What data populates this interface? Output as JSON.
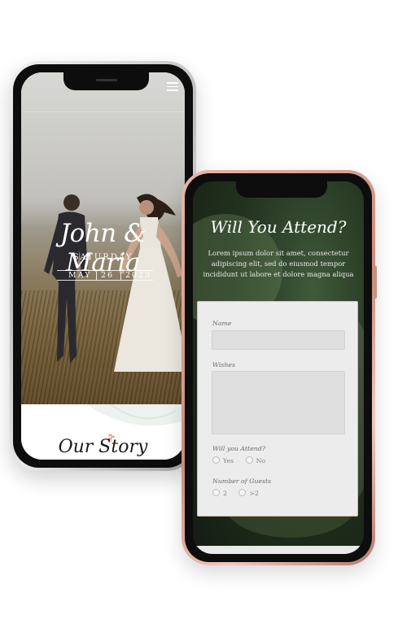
{
  "phone_home": {
    "couple_name": "John & Maria",
    "day": "SATURDAY",
    "date": {
      "month": "MAY",
      "day": "26",
      "year": "2023"
    },
    "section_title": "Our Story",
    "menu_icon": "hamburger-menu-icon"
  },
  "phone_rsvp": {
    "title": "Will You Attend?",
    "description": "Lorem ipsum dolor sit amet, consectetur adipiscing elit, sed do eiusmod tempor incididunt ut labore et dolore magna aliqua",
    "form": {
      "name_label": "Name",
      "name_value": "",
      "wishes_label": "Wishes",
      "wishes_value": "",
      "attend_label": "Will you Attend?",
      "attend_options": [
        "Yes",
        "No"
      ],
      "guests_label": "Number of Guests",
      "guests_options": [
        "2",
        ">2"
      ]
    }
  },
  "colors": {
    "phone_frame_silver": "#c9c9c9",
    "phone_frame_rose": "#c78c7c",
    "rsvp_background": "#23331f",
    "form_card": "#ececec"
  }
}
